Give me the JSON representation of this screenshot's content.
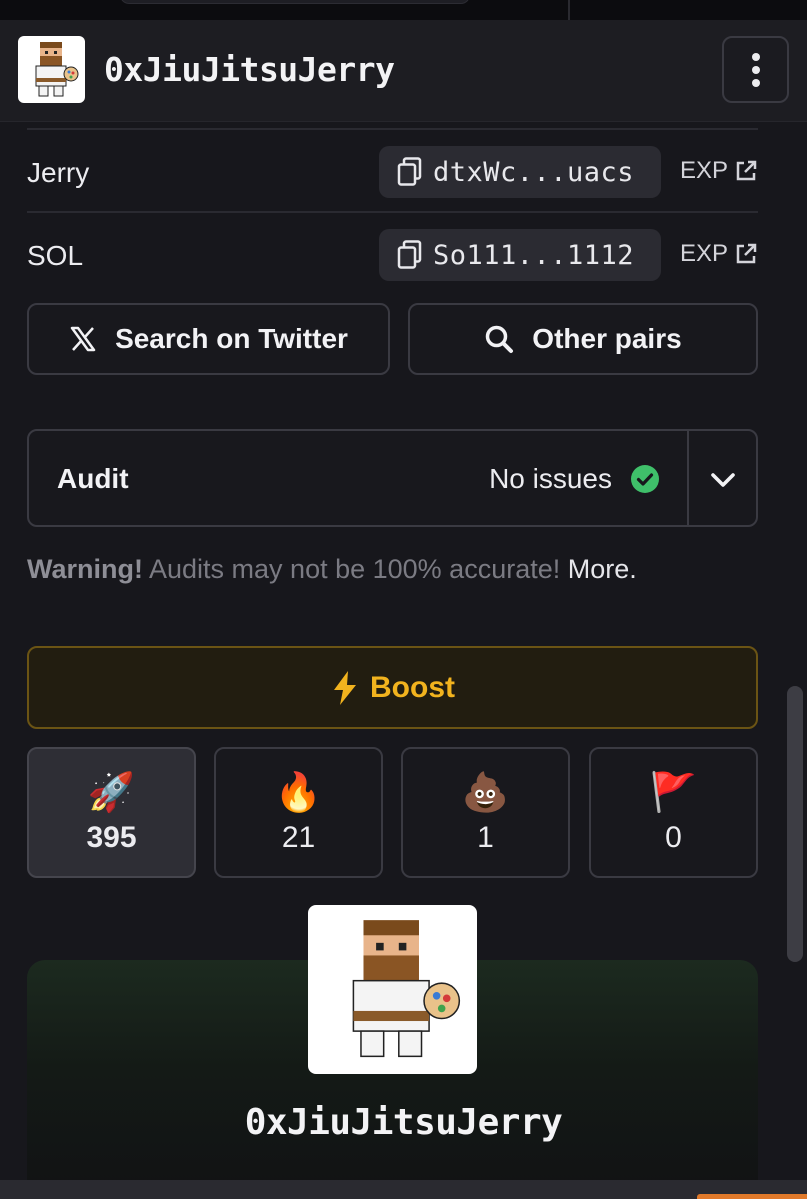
{
  "header": {
    "title": "0xJiuJitsuJerry",
    "avatar_icon": "pixel-jiujitsu-character-icon",
    "menu_icon": "vertical-dots-icon"
  },
  "addresses": [
    {
      "label": "Jerry",
      "address": "dtxWc...uacs",
      "explorer": "EXP"
    },
    {
      "label": "SOL",
      "address": "So111...1112",
      "explorer": "EXP"
    }
  ],
  "actions": {
    "twitter": "Search on Twitter",
    "other_pairs": "Other pairs"
  },
  "audit": {
    "title": "Audit",
    "status": "No issues",
    "status_color": "#3fbf6a"
  },
  "warning": {
    "prefix": "Warning!",
    "text": " Audits may not be 100% accurate! ",
    "more": "More."
  },
  "boost": {
    "label": "Boost",
    "color": "#f2b31e"
  },
  "reactions": [
    {
      "emoji": "🚀",
      "count": "395",
      "name": "rocket"
    },
    {
      "emoji": "🔥",
      "count": "21",
      "name": "fire"
    },
    {
      "emoji": "💩",
      "count": "1",
      "name": "poop"
    },
    {
      "emoji": "🚩",
      "count": "0",
      "name": "red-flag"
    }
  ],
  "card": {
    "title": "0xJiuJitsuJerry"
  }
}
